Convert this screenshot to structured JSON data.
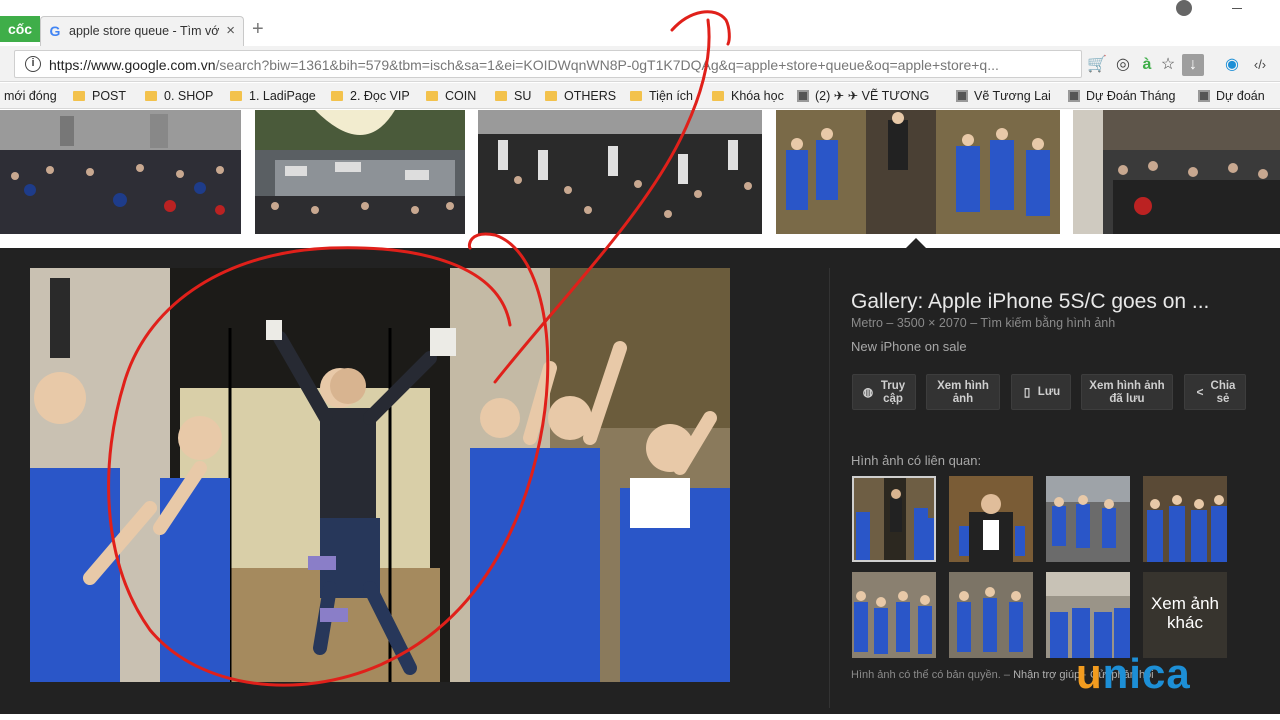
{
  "browser": {
    "app_logo_text": "cốc",
    "tab_title": "apple store queue - Tìm với Google",
    "tab_close": "×",
    "new_tab": "+",
    "url": "https://www.google.com.vn/search?biw=1361&bih=579&tbm=isch&sa=1&ei=KOIDWqnWN8P-0gT1K7DQAg&q=apple+store+queue&oq=apple+store+q...",
    "url_host": "https://www.google.com.vn",
    "url_rest": "/search?biw=1361&bih=579&tbm=isch&sa=1&ei=KOIDWqnWN8P-0gT1K7DQAg&q=apple+store+queue&oq=apple+store+q..."
  },
  "bookmarks": [
    {
      "label": "mới đóng",
      "icon": "none"
    },
    {
      "label": "POST",
      "icon": "folder"
    },
    {
      "label": "0. SHOP",
      "icon": "folder"
    },
    {
      "label": "1. LadiPage",
      "icon": "folder"
    },
    {
      "label": "2. Đọc VIP",
      "icon": "folder"
    },
    {
      "label": "COIN",
      "icon": "folder"
    },
    {
      "label": "SU",
      "icon": "folder"
    },
    {
      "label": "OTHERS",
      "icon": "folder"
    },
    {
      "label": "Tiện ích",
      "icon": "folder"
    },
    {
      "label": "Khóa học",
      "icon": "folder"
    },
    {
      "label": "(2) ✈ ✈ VẼ TƯƠNG",
      "icon": "page"
    },
    {
      "label": "Vẽ Tương Lai",
      "icon": "page"
    },
    {
      "label": "Dự Đoán Tháng",
      "icon": "page"
    },
    {
      "label": "Dự đoán",
      "icon": "page"
    }
  ],
  "preview": {
    "title": "Gallery: Apple iPhone 5S/C goes on ...",
    "source": "Metro",
    "dimensions": "3500 × 2070",
    "search_by_image": "Tìm kiếm bằng hình ảnh",
    "description": "New iPhone on sale",
    "actions": {
      "visit": "Truy cập",
      "view_image": "Xem hình ảnh",
      "save": "Lưu",
      "view_saved": "Xem hình ảnh đã lưu",
      "share": "Chia sẻ"
    },
    "related_label": "Hình ảnh có liên quan:",
    "more_images": "Xem ảnh khác",
    "copyright": "Hình ảnh có thể có bản quyền.",
    "feedback": "Nhận trợ giúp",
    "feedback2": "Gửi phản hồi"
  },
  "watermark": {
    "u": "u",
    "rest": "nica"
  },
  "colors": {
    "panel_bg": "#222222",
    "apple_blue": "#2a56c8",
    "annotation_red": "#e0201a",
    "unica_orange": "#f39c1f",
    "unica_blue": "#1d8fd6"
  }
}
